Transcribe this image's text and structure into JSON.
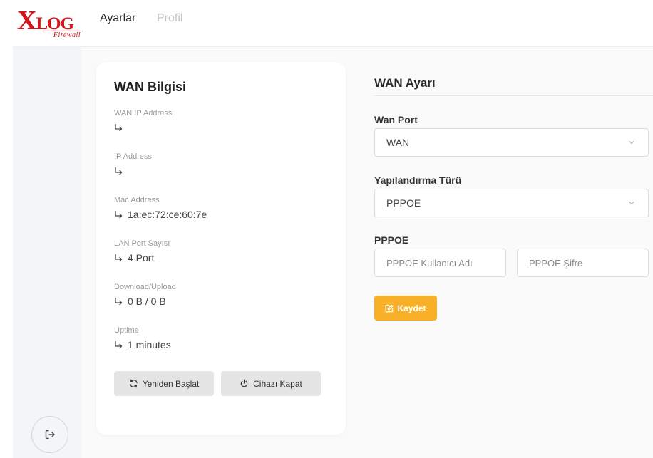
{
  "brand": {
    "logo_x": "X",
    "logo_log": "LOG",
    "logo_sub": "Firewall",
    "color": "#d4141c"
  },
  "nav": {
    "tabs": [
      {
        "label": "Ayarlar",
        "active": true
      },
      {
        "label": "Profil",
        "active": false
      }
    ]
  },
  "sidebar": {
    "logout_icon": "logout-icon"
  },
  "wan_info": {
    "title": "WAN Bilgisi",
    "fields": [
      {
        "label": "WAN IP Address",
        "value": ""
      },
      {
        "label": "IP Address",
        "value": ""
      },
      {
        "label": "Mac Address",
        "value": "1a:ec:72:ce:60:7e"
      },
      {
        "label": "LAN Port Sayısı",
        "value": "4 Port"
      },
      {
        "label": "Download/Upload",
        "value": "0 B / 0 B"
      },
      {
        "label": "Uptime",
        "value": "1 minutes"
      }
    ],
    "buttons": {
      "restart": "Yeniden Başlat",
      "shutdown": "Cihazı Kapat"
    }
  },
  "wan_settings": {
    "title": "WAN Ayarı",
    "wan_port": {
      "label": "Wan Port",
      "value": "WAN"
    },
    "config_type": {
      "label": "Yapılandırma Türü",
      "value": "PPPOE"
    },
    "pppoe": {
      "label": "PPPOE",
      "username_placeholder": "PPPOE Kullanıcı Adı",
      "password_placeholder": "PPPOE Şifre"
    },
    "save_label": "Kaydet"
  },
  "colors": {
    "accent": "#f7b028",
    "sidebar_bg": "#f4f5f7",
    "page_bg": "#fafafa"
  }
}
